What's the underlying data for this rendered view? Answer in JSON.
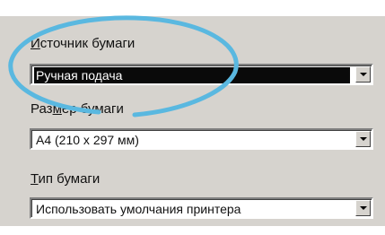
{
  "paper_source": {
    "label_underlined": "И",
    "label_rest": "сточник бумаги",
    "value": "Ручная подача"
  },
  "paper_size": {
    "label_before": "Раз",
    "label_underlined": "м",
    "label_rest": "ер бумаги",
    "value": "A4 (210 x 297 мм)"
  },
  "paper_type": {
    "label_underlined": "Т",
    "label_rest": "ип бумаги",
    "value": "Использовать умолчания принтера"
  },
  "highlight_color": "#5ab8e0",
  "icons": [
    "chevron-down-icon"
  ]
}
